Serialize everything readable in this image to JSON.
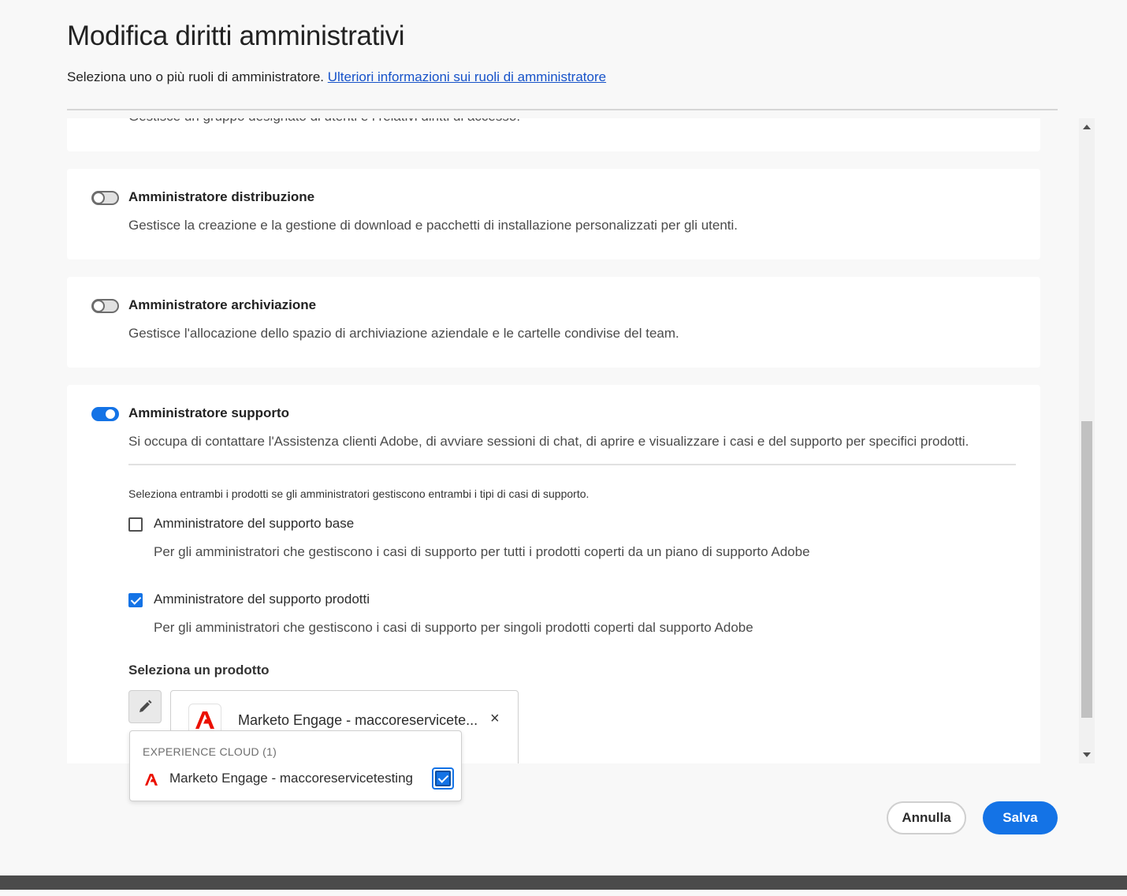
{
  "dialog": {
    "title": "Modifica diritti amministrativi",
    "subtitle": "Seleziona uno o più ruoli di amministratore.",
    "learn_more_link": "Ulteriori informazioni sui ruoli di amministratore"
  },
  "roles": {
    "clipped_description": "Gestisce un gruppo designato di utenti e i relativi diritti di accesso.",
    "items": [
      {
        "title": "Amministratore distribuzione",
        "description": "Gestisce la creazione e la gestione di download e pacchetti di installazione personalizzati per gli utenti.",
        "enabled": false
      },
      {
        "title": "Amministratore archiviazione",
        "description": "Gestisce l'allocazione dello spazio di archiviazione aziendale e le cartelle condivise del team.",
        "enabled": false
      },
      {
        "title": "Amministratore supporto",
        "description": "Si occupa di contattare l'Assistenza clienti Adobe, di avviare sessioni di chat, di aprire e visualizzare i casi e del supporto per specifici prodotti.",
        "enabled": true
      }
    ]
  },
  "support": {
    "hint": "Seleziona entrambi i prodotti se gli amministratori gestiscono entrambi i tipi di casi di supporto.",
    "options": [
      {
        "label": "Amministratore del supporto base",
        "description": "Per gli amministratori che gestiscono i casi di supporto per tutti i prodotti coperti da un piano di supporto Adobe",
        "checked": false
      },
      {
        "label": "Amministratore del supporto prodotti",
        "description": "Per gli amministratori che gestiscono i casi di supporto per singoli prodotti coperti dal supporto Adobe",
        "checked": true
      }
    ],
    "select_product_label": "Seleziona un prodotto",
    "selected_product": "Marketo Engage - maccoreservicete...",
    "remove_symbol": "×"
  },
  "popover": {
    "header": "EXPERIENCE CLOUD (1)",
    "item_label": "Marketo Engage - maccoreservicetesting",
    "item_checked": true
  },
  "footer": {
    "cancel_label": "Annulla",
    "save_label": "Salva"
  },
  "colors": {
    "accent": "#1473e6",
    "adobe_red": "#eb1000",
    "link": "#1652c9"
  }
}
